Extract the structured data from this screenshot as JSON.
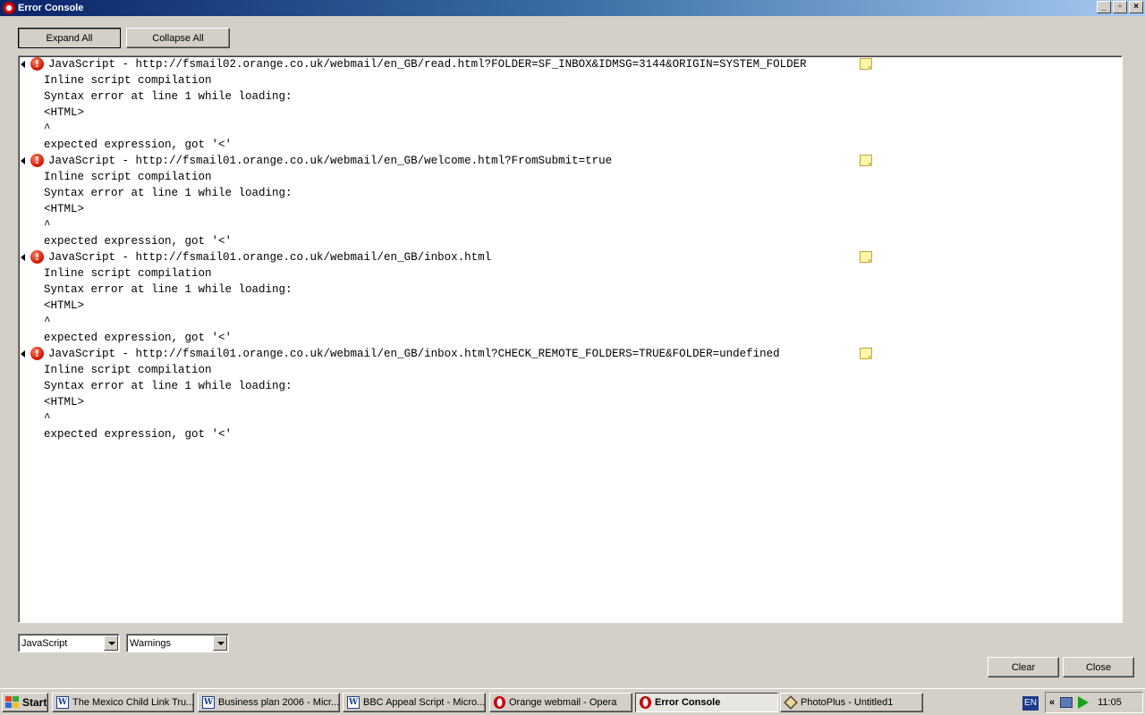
{
  "window": {
    "title": "Error Console",
    "controls": [
      "_",
      "▫",
      "×"
    ]
  },
  "toolbar": {
    "expand_all": "Expand All",
    "collapse_all": "Collapse All"
  },
  "entries": [
    {
      "title": "JavaScript - http://fsmail02.orange.co.uk/webmail/en_GB/read.html?FOLDER=SF_INBOX&IDMSG=3144&ORIGIN=SYSTEM_FOLDER",
      "lines": [
        "Inline script compilation",
        "Syntax error at line 1 while loading:",
        "<HTML>",
        "^",
        "expected expression, got '<'"
      ]
    },
    {
      "title": "JavaScript - http://fsmail01.orange.co.uk/webmail/en_GB/welcome.html?FromSubmit=true",
      "lines": [
        "Inline script compilation",
        "Syntax error at line 1 while loading:",
        "<HTML>",
        "^",
        "expected expression, got '<'"
      ]
    },
    {
      "title": "JavaScript - http://fsmail01.orange.co.uk/webmail/en_GB/inbox.html",
      "lines": [
        "Inline script compilation",
        "Syntax error at line 1 while loading:",
        "<HTML>",
        "^",
        "expected expression, got '<'"
      ]
    },
    {
      "title": "JavaScript - http://fsmail01.orange.co.uk/webmail/en_GB/inbox.html?CHECK_REMOTE_FOLDERS=TRUE&FOLDER=undefined",
      "lines": [
        "Inline script compilation",
        "Syntax error at line 1 while loading:",
        "<HTML>",
        "^",
        "expected expression, got '<'"
      ]
    }
  ],
  "filters": {
    "source": "JavaScript",
    "severity": "Warnings"
  },
  "footer": {
    "clear": "Clear",
    "close": "Close"
  },
  "taskbar": {
    "start": "Start",
    "tasks": [
      {
        "label": "The Mexico Child Link Tru...",
        "icon": "word-icon"
      },
      {
        "label": "Business plan 2006 - Micr...",
        "icon": "word-icon"
      },
      {
        "label": "BBC Appeal Script - Micro...",
        "icon": "word-icon"
      },
      {
        "label": "Orange webmail - Opera",
        "icon": "opera-icon"
      },
      {
        "label": "Error Console",
        "icon": "opera-icon",
        "active": true
      },
      {
        "label": "PhotoPlus - Untitled1",
        "icon": "photoplus-icon"
      }
    ],
    "language": "EN",
    "tray_chevron": "«",
    "clock": "11:05"
  }
}
